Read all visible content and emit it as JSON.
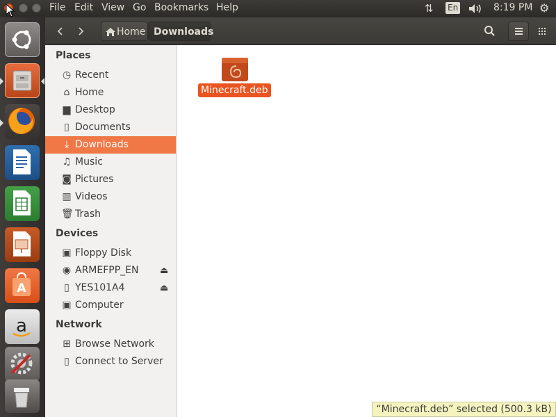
{
  "menubar": {
    "items": [
      "File",
      "Edit",
      "View",
      "Go",
      "Bookmarks",
      "Help"
    ],
    "keyboard": "En",
    "clock": "8:19 PM"
  },
  "launcher": {
    "apps": [
      "ubuntu-dash-icon",
      "files-app-icon",
      "firefox-icon",
      "libreoffice-writer-icon",
      "libreoffice-calc-icon",
      "libreoffice-impress-icon",
      "ubuntu-software-icon",
      "amazon-icon",
      "system-settings-icon",
      "trash-launcher-icon"
    ]
  },
  "header": {
    "breadcrumb": [
      "Home",
      "Downloads"
    ]
  },
  "sidebar": {
    "places_heading": "Places",
    "places": [
      {
        "label": "Recent",
        "icon": "clock-icon"
      },
      {
        "label": "Home",
        "icon": "home-icon"
      },
      {
        "label": "Desktop",
        "icon": "folder-icon"
      },
      {
        "label": "Documents",
        "icon": "document-icon"
      },
      {
        "label": "Downloads",
        "icon": "download-icon"
      },
      {
        "label": "Music",
        "icon": "music-icon"
      },
      {
        "label": "Pictures",
        "icon": "camera-icon"
      },
      {
        "label": "Videos",
        "icon": "film-icon"
      },
      {
        "label": "Trash",
        "icon": "trash-icon"
      }
    ],
    "devices_heading": "Devices",
    "devices": [
      {
        "label": "Floppy Disk",
        "icon": "floppy-icon"
      },
      {
        "label": "ARMEFPP_EN",
        "icon": "disc-icon"
      },
      {
        "label": "YES101A4",
        "icon": "usb-drive-icon"
      },
      {
        "label": "Computer",
        "icon": "computer-icon"
      }
    ],
    "network_heading": "Network",
    "network": [
      {
        "label": "Browse Network",
        "icon": "network-icon"
      },
      {
        "label": "Connect to Server",
        "icon": "server-icon"
      }
    ]
  },
  "files": [
    {
      "name": "Minecraft.deb",
      "icon": "debian-package-icon"
    }
  ],
  "status": {
    "text": "“Minecraft.deb” selected  (500.3 kB)"
  },
  "colors": {
    "accent": "#f07746",
    "file_selected": "#e95420"
  }
}
